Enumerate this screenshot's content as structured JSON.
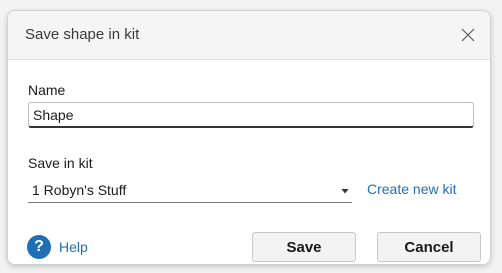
{
  "dialog": {
    "title": "Save shape in kit",
    "close_icon": "close-icon"
  },
  "name_field": {
    "label": "Name",
    "value": "Shape"
  },
  "kit_field": {
    "label": "Save in kit",
    "selected": "1 Robyn's Stuff",
    "chevron_icon": "chevron-down-icon"
  },
  "create_kit_link": "Create new kit",
  "help": {
    "icon": "help-icon",
    "icon_glyph": "?",
    "label": "Help"
  },
  "buttons": {
    "save": "Save",
    "cancel": "Cancel"
  },
  "colors": {
    "accent": "#1f6fb5",
    "background": "#f3f3f3",
    "content": "#ffffff"
  }
}
